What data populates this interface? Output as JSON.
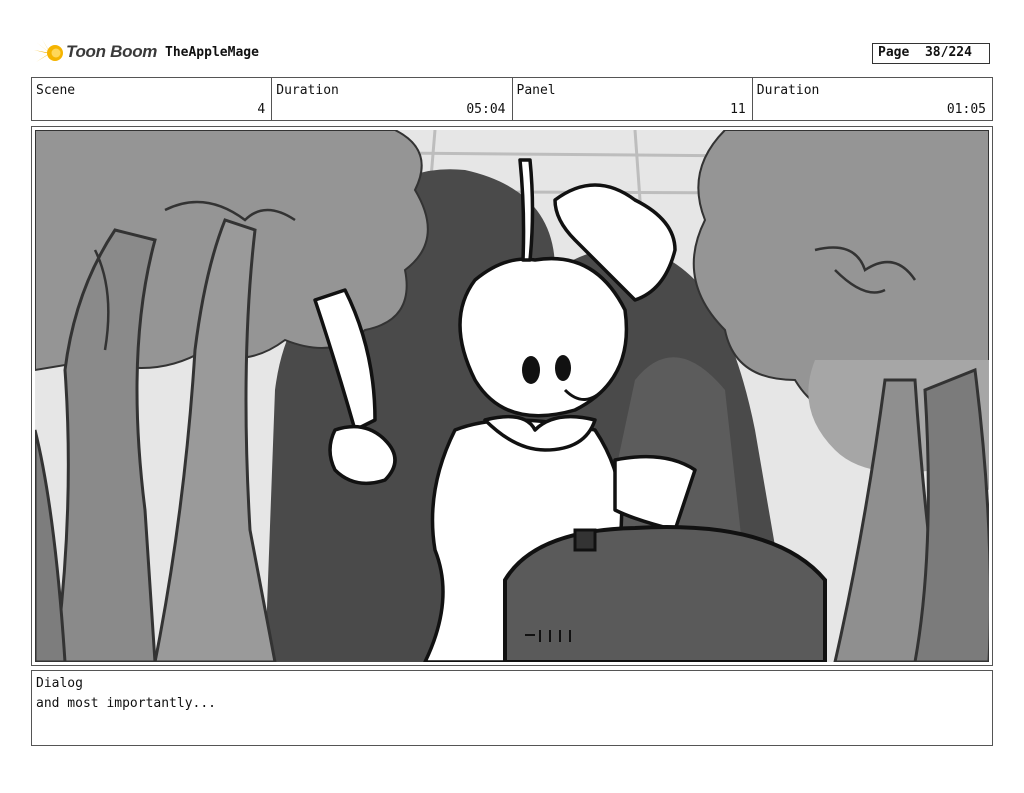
{
  "header": {
    "logo_text": "Toon Boom",
    "project": "TheAppleMage",
    "page_label": "Page",
    "page_value": "38/224"
  },
  "info": {
    "scene_label": "Scene",
    "scene_value": "4",
    "duration1_label": "Duration",
    "duration1_value": "05:04",
    "panel_label": "Panel",
    "panel_value": "11",
    "duration2_label": "Duration",
    "duration2_value": "01:05"
  },
  "dialog": {
    "label": "Dialog",
    "text": "and most importantly..."
  },
  "colors": {
    "logo_accent": "#f5b400",
    "frame_border": "#555555"
  }
}
